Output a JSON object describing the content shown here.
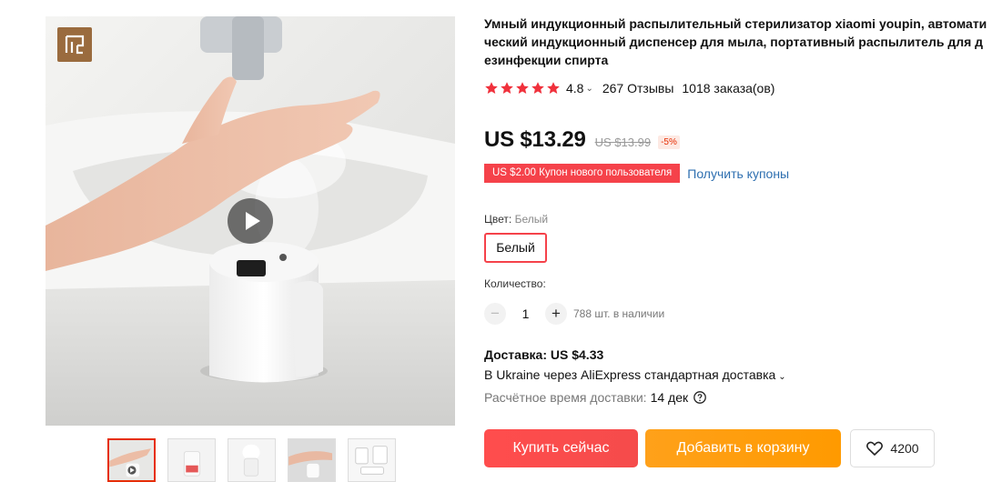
{
  "gallery": {
    "brand_logo_icon": "youpin-logo-icon",
    "play_icon": "play-icon",
    "thumbnails": [
      {
        "name": "thumbnail-hand-dispenser",
        "active": true
      },
      {
        "name": "thumbnail-dispenser-spray",
        "active": false
      },
      {
        "name": "thumbnail-dispenser-light",
        "active": false
      },
      {
        "name": "thumbnail-sink-hand",
        "active": false
      },
      {
        "name": "thumbnail-package-contents",
        "active": false
      }
    ]
  },
  "product": {
    "title": "Умный индукционный распылительный стерилизатор xiaomi youpin, автоматический индукционный диспенсер для мыла, портативный распылитель для дезинфекции спирта",
    "rating": "4.8",
    "reviews": "267 Отзывы",
    "orders": "1018 заказа(ов)",
    "stars_count": 5,
    "price": "US $13.29",
    "old_price": "US $13.99",
    "discount": "-5%",
    "coupon": "US $2.00 Купон нового пользователя",
    "get_coupons": "Получить купоны",
    "color_label": "Цвет:",
    "color_value": "Белый",
    "color_option": "Белый",
    "quantity_label": "Количество:",
    "quantity": "1",
    "quantity_minus": "−",
    "quantity_plus": "+",
    "stock": "788 шт. в наличии",
    "shipping_title": "Доставка: US $4.33",
    "shipping_method": "В Ukraine через AliExpress стандартная доставка",
    "delivery_time_label": "Расчётное время доставки:",
    "delivery_time_value": "14 дек",
    "buy_now": "Купить сейчас",
    "add_to_cart": "Добавить в корзину",
    "wishlist_count": "4200"
  },
  "colors": {
    "accent_red": "#f5424a",
    "accent_orange": "#ff9a00",
    "link_blue": "#2e6fb0",
    "star": "#f0313c",
    "brand_logo_bg": "#9a6b3e"
  }
}
